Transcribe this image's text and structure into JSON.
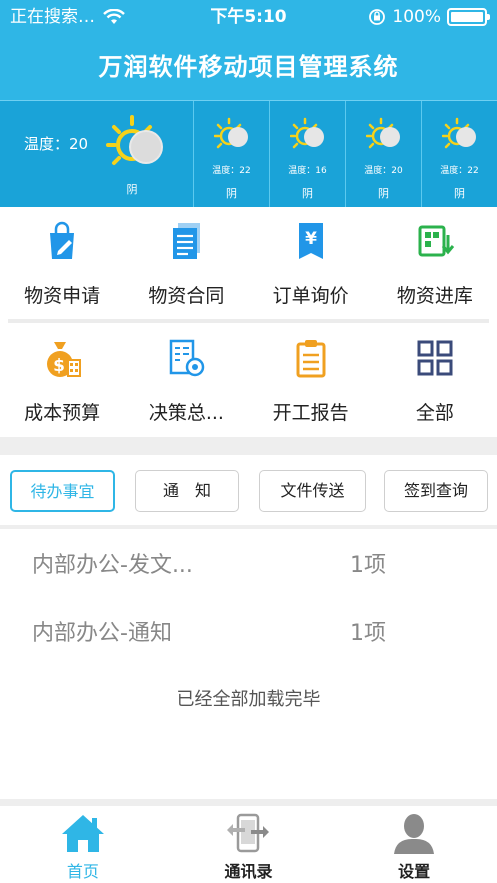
{
  "status_bar": {
    "carrier": "正在搜索…",
    "time": "下午5:10",
    "battery": "100%",
    "battery_level": 1.0
  },
  "header": {
    "title": "万润软件移动项目管理系统"
  },
  "weather": {
    "current": {
      "temp_label": "温度：20",
      "condition": "阴"
    },
    "forecast": [
      {
        "temp": "温度：22",
        "condition": "阴"
      },
      {
        "temp": "温度：16",
        "condition": "阴"
      },
      {
        "temp": "温度：20",
        "condition": "阴"
      },
      {
        "temp": "温度：22",
        "condition": "阴"
      }
    ],
    "icon": "sun-cloud-icon"
  },
  "grid": {
    "row1": [
      {
        "label": "物资申请",
        "icon": "shopping-bag-icon",
        "color": "#2196e8"
      },
      {
        "label": "物资合同",
        "icon": "document-icon",
        "color": "#2196e8"
      },
      {
        "label": "订单询价",
        "icon": "yen-document-icon",
        "color": "#2196e8"
      },
      {
        "label": "物资进库",
        "icon": "storage-icon",
        "color": "#2bb24c"
      }
    ],
    "row2": [
      {
        "label": "成本预算",
        "icon": "money-bag-icon",
        "color": "#f0a020"
      },
      {
        "label": "决策总...",
        "icon": "decision-doc-icon",
        "color": "#2196e8"
      },
      {
        "label": "开工报告",
        "icon": "clipboard-icon",
        "color": "#f0a020"
      },
      {
        "label": "全部",
        "icon": "grid-icon",
        "color": "#3a4a7a"
      }
    ]
  },
  "tabs": [
    {
      "label": "待办事宜",
      "active": true
    },
    {
      "label": "通　知",
      "active": false
    },
    {
      "label": "文件传送",
      "active": false
    },
    {
      "label": "签到查询",
      "active": false
    }
  ],
  "list": {
    "items": [
      {
        "name": "内部办公-发文...",
        "count": "1项"
      },
      {
        "name": "内部办公-通知",
        "count": "1项"
      }
    ],
    "footer": "已经全部加载完毕"
  },
  "bottom_nav": [
    {
      "label": "首页",
      "icon": "home-icon",
      "active": true
    },
    {
      "label": "通讯录",
      "icon": "phone-transfer-icon",
      "active": false
    },
    {
      "label": "设置",
      "icon": "person-icon",
      "active": false
    }
  ],
  "colors": {
    "accent": "#2fb6e6",
    "weather_bg": "#1aa3d8"
  }
}
